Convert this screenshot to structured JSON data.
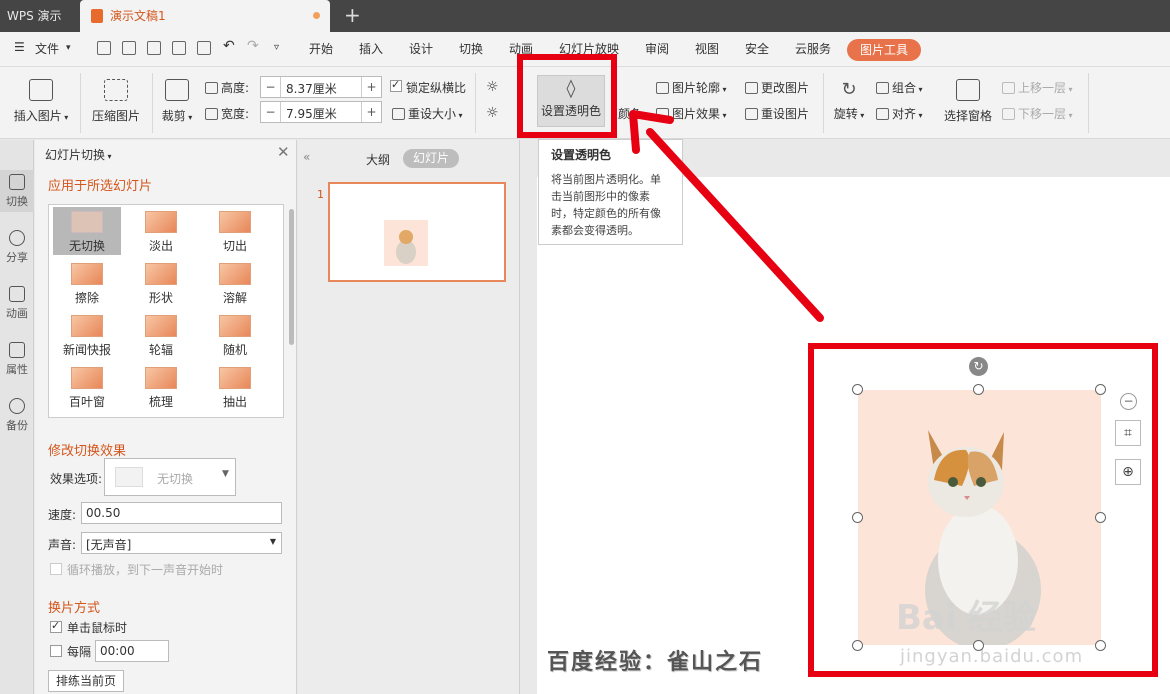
{
  "titlebar": {
    "app": "WPS 演示",
    "doc": "演示文稿1",
    "new_tab": "+"
  },
  "menu": {
    "file": "文件",
    "items": [
      "开始",
      "插入",
      "设计",
      "切换",
      "动画",
      "幻灯片放映",
      "审阅",
      "视图",
      "安全",
      "云服务"
    ],
    "picture_tools": "图片工具"
  },
  "ribbon": {
    "insert_picture": "插入图片",
    "compress": "压缩图片",
    "crop": "裁剪",
    "height_label": "高度:",
    "height_value": "8.37厘米",
    "width_label": "宽度:",
    "width_value": "7.95厘米",
    "lock_ratio": "锁定纵横比",
    "reset_size": "重设大小",
    "set_transparent": "设置透明色",
    "color": "颜色",
    "outline": "图片轮廓",
    "effect": "图片效果",
    "change": "更改图片",
    "reset": "重设图片",
    "rotate": "旋转",
    "group": "组合",
    "align": "对齐",
    "selection_pane": "选择窗格",
    "bring_forward": "上移一层",
    "send_backward": "下移一层"
  },
  "tooltip": {
    "title": "设置透明色",
    "body": "将当前图片透明化。单击当前图形中的像素时，特定颜色的所有像素都会变得透明。"
  },
  "rail": [
    "切换",
    "分享",
    "动画",
    "属性",
    "备份"
  ],
  "panel": {
    "title": "幻灯片切换",
    "apply": "应用于所选幻灯片",
    "transitions": [
      "无切换",
      "淡出",
      "切出",
      "擦除",
      "形状",
      "溶解",
      "新闻快报",
      "轮辐",
      "随机",
      "百叶窗",
      "梳理",
      "抽出"
    ],
    "modify": "修改切换效果",
    "effect_label": "效果选项:",
    "effect_value": "无切换",
    "speed_label": "速度:",
    "speed_value": "00.50",
    "sound_label": "声音:",
    "sound_value": "[无声音]",
    "loop": "循环播放，到下一声音开始时",
    "switch_mode": "换片方式",
    "on_click": "单击鼠标时",
    "every": "每隔",
    "every_value": "00:00",
    "apply_current": "排练当前页"
  },
  "slides": {
    "outline_tab": "大纲",
    "slides_tab": "幻灯片",
    "number": "1"
  },
  "watermark": {
    "caption": "百度经验：雀山之石",
    "brand": "Bai 经验",
    "url": "jingyan.baidu.com"
  },
  "colors": {
    "accent": "#e8734a",
    "annotation": "#e60012",
    "picture_bg": "#fde4d8"
  }
}
